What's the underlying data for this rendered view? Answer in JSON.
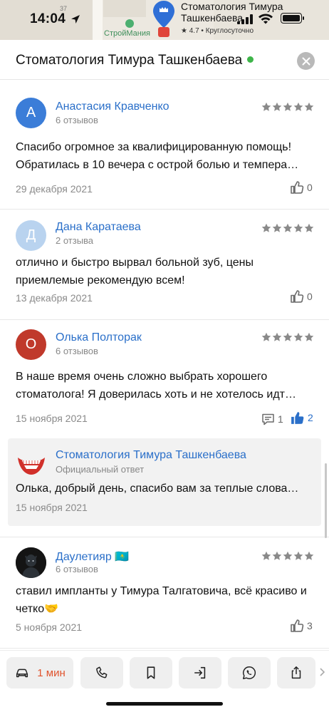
{
  "status_bar": {
    "time": "14:04"
  },
  "map": {
    "place_title": "Стоматология Тимура Ташкенбаева",
    "place_sub": "★ 4.7 • Круглосуточно",
    "shop_label": "СтройМания",
    "number_label": "37"
  },
  "header": {
    "title": "Стоматология Тимура Ташкенбаева"
  },
  "reviews": [
    {
      "initial": "А",
      "avatar_color": "#3b7dd8",
      "author": "Анастасия Кравченко",
      "count": "6 отзывов",
      "text": "Спасибо огромное за квалифицированную помощь! Обратилась в 10 вечера с острой болью и темпера…",
      "date": "29 декабря 2021",
      "likes": "0"
    },
    {
      "initial": "Д",
      "avatar_color": "#b9d3ef",
      "author": "Дана Каратаева",
      "count": "2 отзыва",
      "text": "отлично и быстро вырвал больной зуб, цены приемлемые рекомендую всем!",
      "date": "13 декабря 2021",
      "likes": "0"
    },
    {
      "initial": "О",
      "avatar_color": "#c0392b",
      "author": "Олька Полторак",
      "count": "6 отзывов",
      "text": "В наше время очень сложно выбрать хорошего стоматолога! Я доверилась хоть и не хотелось идт…",
      "date": "15 ноября 2021",
      "replies": "1",
      "likes": "2",
      "official_reply": {
        "name": "Стоматология Тимура Ташкенбаева",
        "label": "Официальный ответ",
        "text": "Олька, добрый день, спасибо вам за теплые слова…",
        "date": "15 ноября 2021"
      }
    },
    {
      "author": "Даулетияр 🇰🇿",
      "count": "6 отзывов",
      "text": "ставил импланты у Тимура Талгатовича, всё красиво и четко🤝",
      "date": "5 ноября 2021",
      "likes": "3"
    }
  ],
  "toolbar": {
    "route_label": "1 мин",
    "buttons": [
      "car-icon",
      "phone-icon",
      "bookmark-icon",
      "enter-icon",
      "whatsapp-icon",
      "share-icon",
      "chevron-right-icon"
    ]
  },
  "colors": {
    "link": "#2a6fc9",
    "star": "#8a8a8a",
    "like_active": "#2a6fc9",
    "route": "#e0542e",
    "open_dot": "#3fb54a"
  }
}
